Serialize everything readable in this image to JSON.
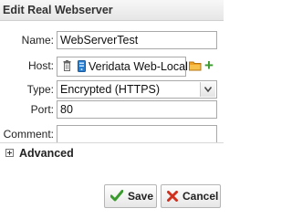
{
  "dialog": {
    "title": "Edit Real Webserver"
  },
  "form": {
    "name": {
      "label": "Name:",
      "value": "WebServerTest"
    },
    "host": {
      "label": "Host:",
      "value": "Veridata Web-Local"
    },
    "type": {
      "label": "Type:",
      "value": "Encrypted (HTTPS)"
    },
    "port": {
      "label": "Port:",
      "value": "80"
    },
    "comment": {
      "label": "Comment:",
      "value": ""
    }
  },
  "advanced": {
    "label": "Advanced",
    "icon": "expand-plus-icon"
  },
  "buttons": {
    "save": "Save",
    "cancel": "Cancel"
  },
  "colors": {
    "save_check": "#3a9a2e",
    "cancel_x": "#d0301e",
    "add": "#3a9a2e",
    "folder": "#f0a020",
    "server": "#2b7fd0"
  }
}
